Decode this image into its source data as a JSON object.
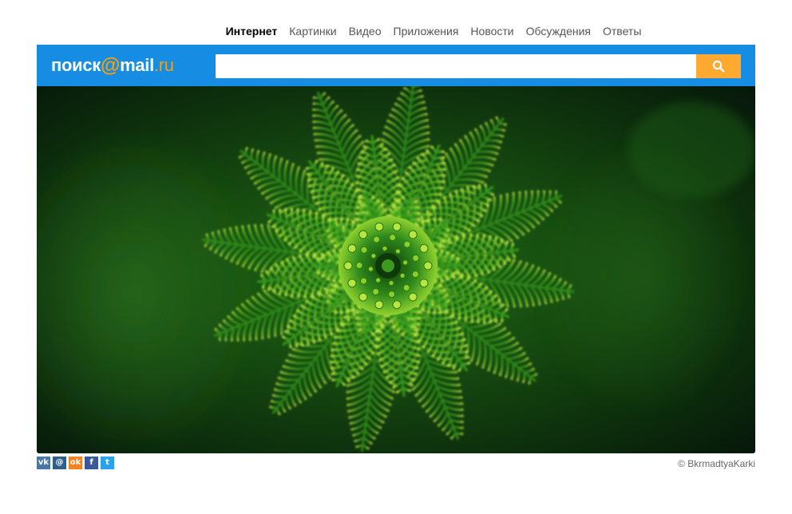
{
  "nav": {
    "items": [
      {
        "label": "Интернет",
        "active": true
      },
      {
        "label": "Картинки",
        "active": false
      },
      {
        "label": "Видео",
        "active": false
      },
      {
        "label": "Приложения",
        "active": false
      },
      {
        "label": "Новости",
        "active": false
      },
      {
        "label": "Обсуждения",
        "active": false
      },
      {
        "label": "Ответы",
        "active": false
      }
    ]
  },
  "logo": {
    "word": "поиск",
    "at": "@",
    "brand": "mail",
    "tld": ".ru"
  },
  "search": {
    "value": "",
    "placeholder": "",
    "button_icon": "search-icon"
  },
  "hero": {
    "subject": "green-fern-plant-photo"
  },
  "footer": {
    "social": [
      {
        "name": "vk-icon",
        "glyph": "vk",
        "color": "#4a76a8"
      },
      {
        "name": "mailru-icon",
        "glyph": "@",
        "color": "#2f5e8c"
      },
      {
        "name": "odnoklassniki-icon",
        "glyph": "ok",
        "color": "#f58220"
      },
      {
        "name": "facebook-icon",
        "glyph": "f",
        "color": "#3b5998"
      },
      {
        "name": "twitter-icon",
        "glyph": "t",
        "color": "#2aa3ef"
      }
    ],
    "credit": "© BkrmadtyaKarki"
  },
  "colors": {
    "bar": "#168de2",
    "accent": "#ff9e00",
    "button": "#ffa930"
  }
}
